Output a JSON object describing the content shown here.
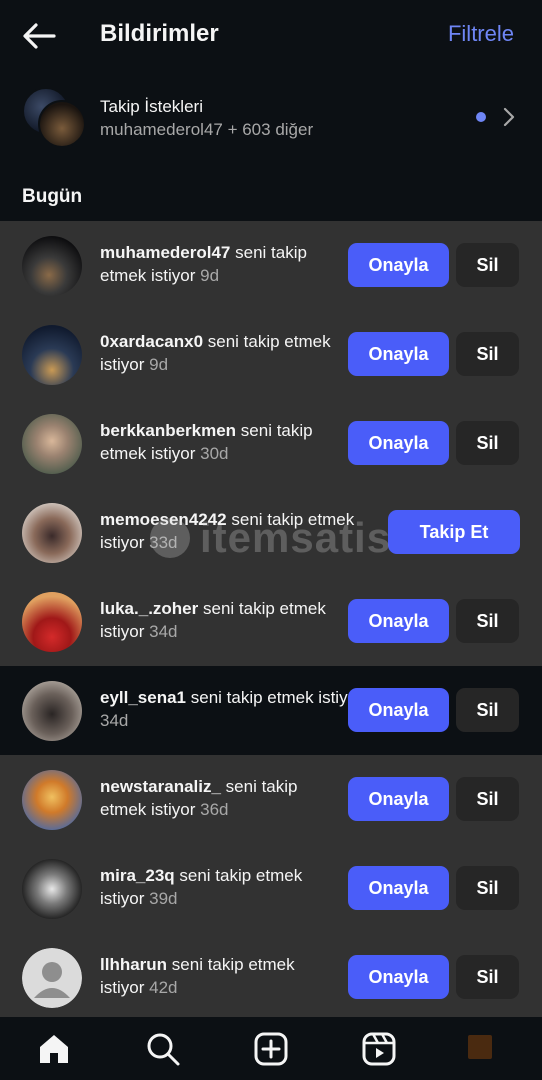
{
  "header": {
    "title": "Bildirimler",
    "filter_label": "Filtrele"
  },
  "follow_requests": {
    "title": "Takip İstekleri",
    "subtitle": "muhamederol47 + 603 diğer"
  },
  "section_title": "Bugün",
  "requests": [
    {
      "username": "muhamederol47",
      "message": " seni takip etmek istiyor",
      "age": " 9d",
      "action": "Onayla",
      "secondary": "Sil",
      "highlight": true
    },
    {
      "username": "0xardacanx0",
      "message": " seni takip etmek istiyor",
      "age": " 9d",
      "action": "Onayla",
      "secondary": "Sil",
      "highlight": true
    },
    {
      "username": "berkkanberkmen",
      "message": " seni takip etmek istiyor",
      "age": " 30d",
      "action": "Onayla",
      "secondary": "Sil",
      "highlight": true
    },
    {
      "username": "memoesen4242",
      "message": " seni takip etmek istiyor",
      "age": " 33d",
      "action": "Takip Et",
      "highlight": true
    },
    {
      "username": "luka._.zoher",
      "message": " seni takip etmek istiyor",
      "age": " 34d",
      "action": "Onayla",
      "secondary": "Sil",
      "highlight": true
    },
    {
      "username": "eyll_sena1",
      "message": " seni takip etmek istiyor",
      "age": " 34d",
      "action": "Onayla",
      "secondary": "Sil",
      "highlight": false
    },
    {
      "username": "newstaranaliz_",
      "message": " seni takip etmek istiyor",
      "age": " 36d",
      "action": "Onayla",
      "secondary": "Sil",
      "highlight": true
    },
    {
      "username": "mira_23q",
      "message": " seni takip etmek istiyor",
      "age": " 39d",
      "action": "Onayla",
      "secondary": "Sil",
      "highlight": true
    },
    {
      "username": "llhharun",
      "message": " seni takip etmek istiyor",
      "age": " 42d",
      "action": "Onayla",
      "secondary": "Sil",
      "highlight": true
    }
  ],
  "watermark": "itemsatis",
  "colors": {
    "accent": "#4a5df9",
    "link": "#6f86f5",
    "background": "#0c1014",
    "row_highlight": "#323232"
  },
  "tabbar": {
    "icons": [
      "home-icon",
      "search-icon",
      "create-icon",
      "reels-icon",
      "profile-icon"
    ]
  }
}
